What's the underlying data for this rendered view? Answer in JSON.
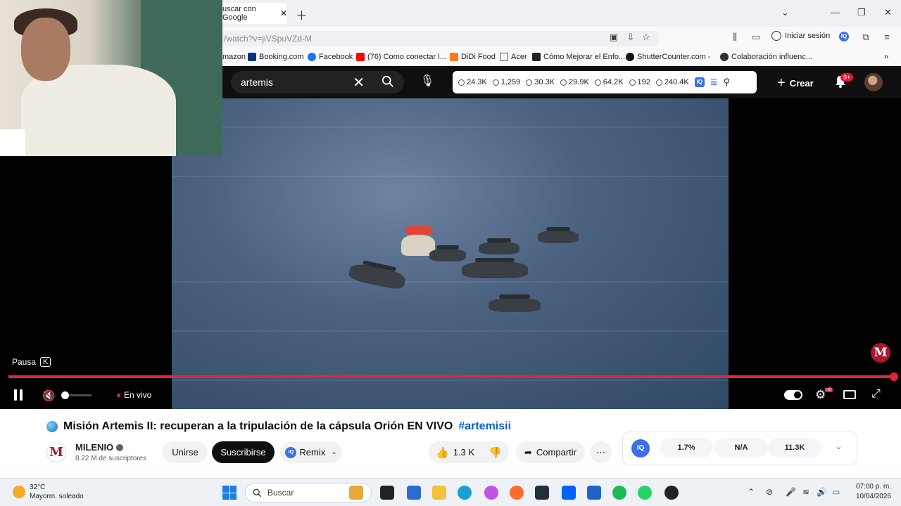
{
  "browser": {
    "tab_title": "uscar con Google",
    "url": "/watch?v=jiVSpuVZd-M",
    "signin_label": "Iniciar sesión",
    "bookmarks": [
      {
        "label": "mazon",
        "icon": "amazon-icon"
      },
      {
        "label": "Booking.com",
        "icon": "booking-icon"
      },
      {
        "label": "Facebook",
        "icon": "facebook-icon"
      },
      {
        "label": "(76) Como conectar l...",
        "icon": "youtube-icon"
      },
      {
        "label": "DiDi Food",
        "icon": "didi-icon"
      },
      {
        "label": "Acer",
        "icon": "folder-icon"
      },
      {
        "label": "Cómo Mejorar el Enfo...",
        "icon": "article-icon"
      },
      {
        "label": "ShutterCounter.com -",
        "icon": "shutter-icon"
      },
      {
        "label": "Colaboración influenc...",
        "icon": "collab-icon"
      }
    ]
  },
  "youtube": {
    "search_value": "artemis",
    "stats": [
      "24.3K",
      "1,259",
      "30.3K",
      "29.9K",
      "64.2K",
      "192",
      "240.4K"
    ],
    "iq_label": "IQ",
    "create_label": "Crear",
    "notification_badge": "9+"
  },
  "player": {
    "pause_tooltip": "Pausa",
    "pause_key": "K",
    "live_label": "En vivo",
    "progress": 1.0,
    "hd_badge": "HD",
    "watermark": "M"
  },
  "video_info": {
    "title": "Misión Artemis II: recuperan a la tripulación de la cápsula Orión EN VIVO",
    "hashtag": "#artemisii",
    "channel_name": "MILENIO",
    "channel_logo": "M",
    "subscribers": "8.22 M de suscriptores",
    "join_label": "Unirse",
    "subscribe_label": "Suscribirse",
    "remix_label": "Remix",
    "likes": "1.3 K",
    "share_label": "Compartir"
  },
  "iq_panel": {
    "logo": "IQ",
    "values": [
      "1.7%",
      "N/A",
      "11.3K"
    ]
  },
  "taskbar": {
    "temperature": "32°C",
    "weather": "Mayorm. soleado",
    "search_placeholder": "Buscar",
    "time": "07:00 p. m.",
    "date": "10/04/2026"
  },
  "colors": {
    "youtube_red": "#e52237",
    "iq_blue": "#3d6ee7",
    "milenio_red": "#a6192e"
  }
}
